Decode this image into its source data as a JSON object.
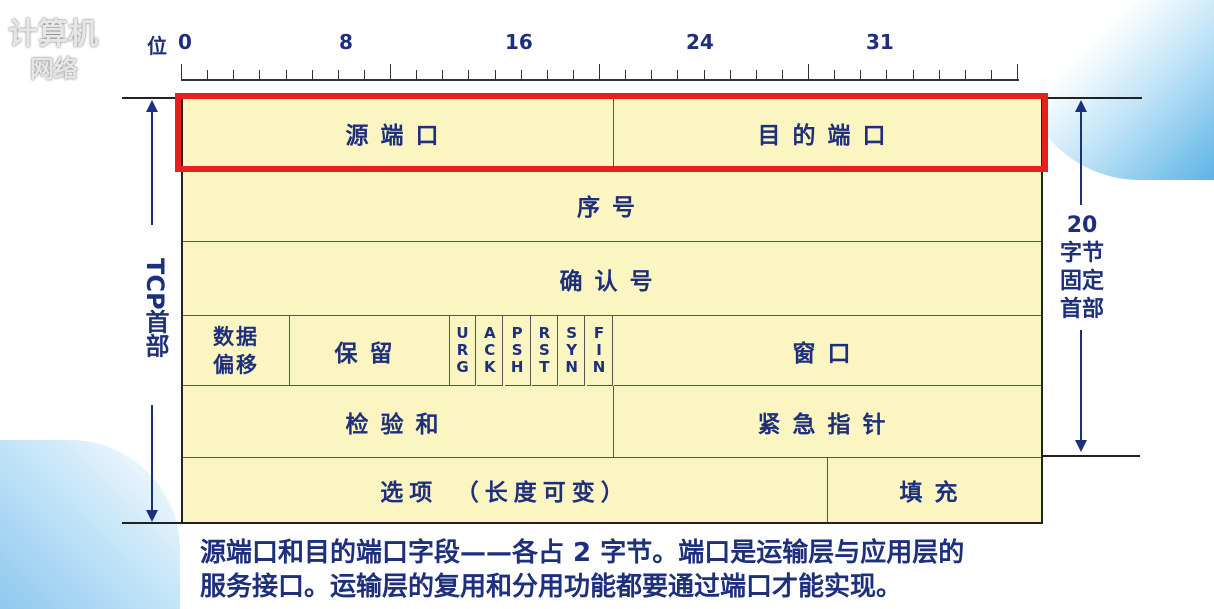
{
  "logo": {
    "line1": "计算机",
    "line2": "网络"
  },
  "ruler": {
    "label": "位",
    "ticks": [
      "0",
      "8",
      "16",
      "24",
      "31"
    ]
  },
  "header": {
    "source_port": "源端口",
    "dest_port": "目的端口",
    "seq": "序号",
    "ack": "确认号",
    "data_offset_line1": "数据",
    "data_offset_line2": "偏移",
    "reserved": "保留",
    "flags": [
      {
        "letters": [
          "U",
          "R",
          "G"
        ]
      },
      {
        "letters": [
          "A",
          "C",
          "K"
        ]
      },
      {
        "letters": [
          "P",
          "S",
          "H"
        ]
      },
      {
        "letters": [
          "R",
          "S",
          "T"
        ]
      },
      {
        "letters": [
          "S",
          "Y",
          "N"
        ]
      },
      {
        "letters": [
          "F",
          "I",
          "N"
        ]
      }
    ],
    "window": "窗口",
    "checksum": "检验和",
    "urgent_pointer": "紧急指针",
    "options": "选项　（长度可变）",
    "padding": "填充"
  },
  "side_left": {
    "label": "TCP首部"
  },
  "side_right": {
    "size": "20",
    "line1": "字节",
    "line2": "固定",
    "line3": "首部"
  },
  "caption": {
    "line1": "源端口和目的端口字段——各占 2 字节。端口是运输层与应用层的",
    "line2": "服务接口。运输层的复用和分用功能都要通过端口才能实现。"
  },
  "colors": {
    "table_fill": "#fbf5c2",
    "text": "#1e2f7c",
    "highlight": "#e8201a"
  }
}
